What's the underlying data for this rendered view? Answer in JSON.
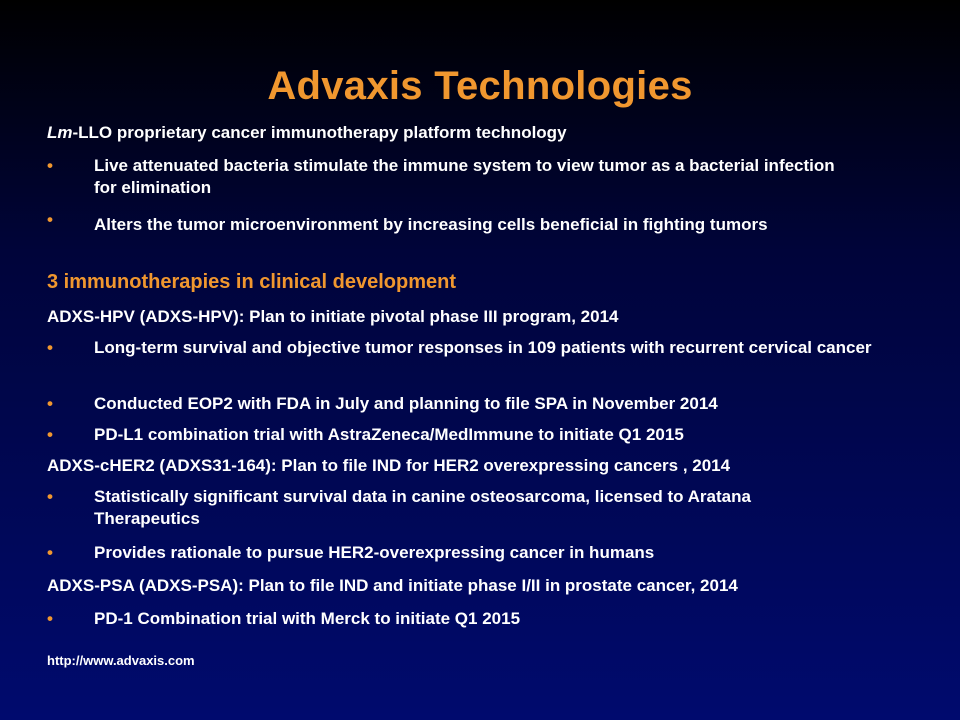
{
  "title": "Advaxis Technologies",
  "platform": {
    "prefix": "Lm",
    "rest": "-LLO proprietary cancer immunotherapy platform technology",
    "bullets": [
      "Live attenuated bacteria stimulate the immune system to view tumor as a bacterial infection for elimination",
      "Alters the tumor microenvironment by increasing cells beneficial in fighting tumors"
    ]
  },
  "clinical_heading": "3 immunotherapies in clinical development",
  "hpv": {
    "heading": "ADXS-HPV (ADXS-HPV): Plan to initiate pivotal phase III program, 2014",
    "bullets": [
      "Long-term survival and objective tumor responses in 109 patients with recurrent cervical cancer",
      "Conducted EOP2 with FDA in July and planning to file SPA in November 2014",
      "PD-L1 combination trial with AstraZeneca/MedImmune to initiate Q1 2015"
    ]
  },
  "cher2": {
    "heading": "ADXS-cHER2 (ADXS31-164): Plan to file IND for HER2 overexpressing cancers , 2014",
    "bullets": [
      "Statistically significant survival data in canine osteosarcoma, licensed to Aratana Therapeutics",
      "Provides rationale to pursue HER2-overexpressing cancer in humans"
    ]
  },
  "psa": {
    "heading": "ADXS-PSA (ADXS-PSA): Plan to file IND and initiate phase I/II in prostate cancer, 2014",
    "bullets": [
      "PD-1 Combination trial with Merck to initiate Q1 2015"
    ]
  },
  "bullet_char": "•",
  "footer_url": "http://www.advaxis.com",
  "colors": {
    "accent": "#f0972f",
    "text": "#ffffff",
    "background_top": "#000000",
    "background_bottom": "#000a6e"
  }
}
